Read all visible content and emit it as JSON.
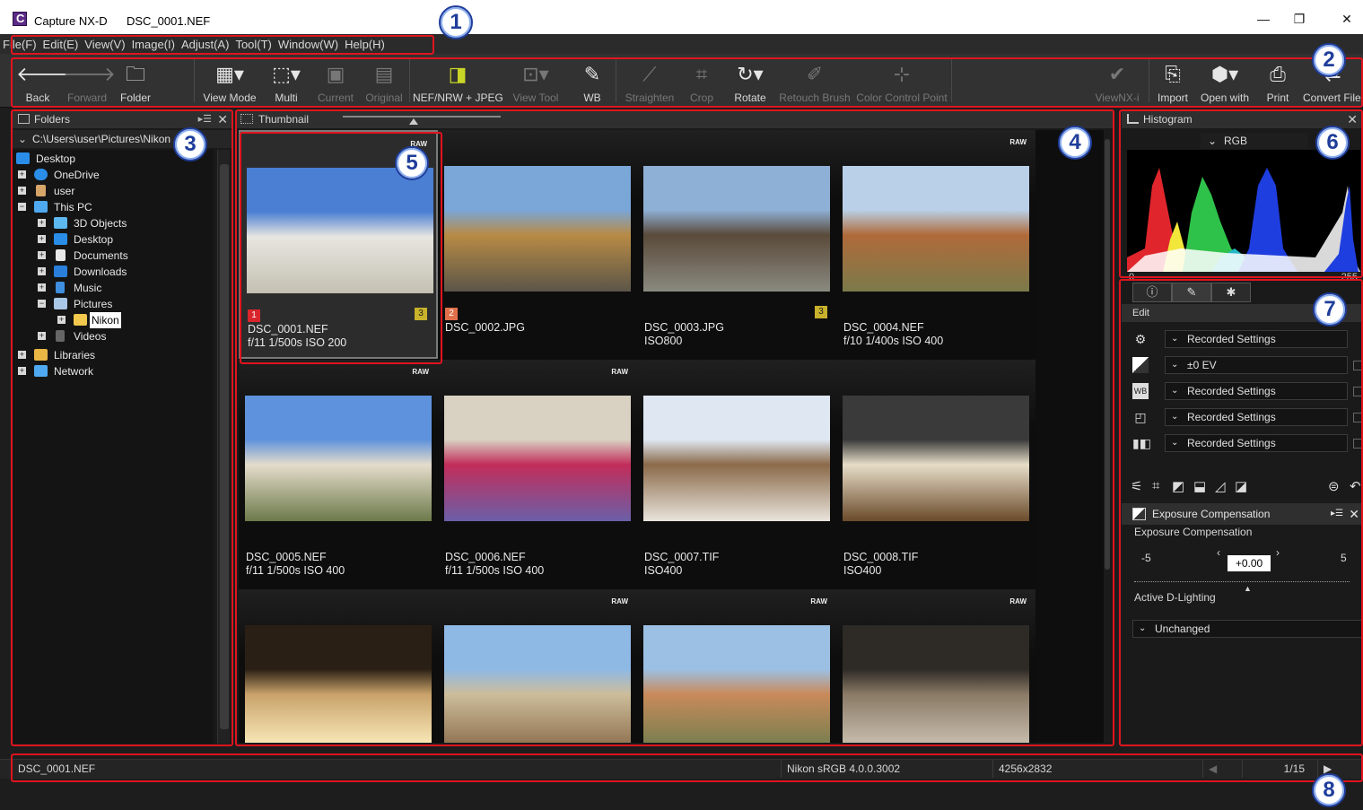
{
  "titlebar": {
    "app": "Capture NX-D",
    "file": "DSC_0001.NEF",
    "minimize": "—",
    "restore": "❐",
    "close": "✕"
  },
  "menu": [
    "File(F)",
    "Edit(E)",
    "View(V)",
    "Image(I)",
    "Adjust(A)",
    "Tool(T)",
    "Window(W)",
    "Help(H)"
  ],
  "toolbar": {
    "back": "Back",
    "forward": "Forward",
    "folder": "Folder",
    "view_mode": "View Mode",
    "multi": "Multi",
    "current": "Current",
    "original": "Original",
    "nef_jpeg": "NEF/NRW + JPEG",
    "view_tool": "View Tool",
    "wb": "WB",
    "straighten": "Straighten",
    "crop": "Crop",
    "rotate": "Rotate",
    "retouch": "Retouch Brush",
    "ccp": "Color Control Point",
    "viewnx": "ViewNX-i",
    "import": "Import",
    "open_with": "Open with",
    "print": "Print",
    "convert": "Convert Files"
  },
  "folders": {
    "title": "Folders",
    "path": "C:\\Users\\user\\Pictures\\Nikon",
    "tree": [
      "Desktop",
      "OneDrive",
      "user",
      "This PC",
      "3D Objects",
      "Desktop",
      "Documents",
      "Downloads",
      "Music",
      "Pictures",
      "Nikon",
      "Videos",
      "Libraries",
      "Network"
    ]
  },
  "thumbnail": {
    "title": "Thumbnail",
    "badge": "RAW",
    "items": [
      {
        "name": "DSC_0001.NEF",
        "meta": "f/11 1/500s ISO 200",
        "label": "1",
        "label_color": "#d9262c",
        "star": "3",
        "raw": true
      },
      {
        "name": "DSC_0002.JPG",
        "meta": "",
        "label": "2",
        "label_color": "#e0704a",
        "star": "",
        "raw": false
      },
      {
        "name": "DSC_0003.JPG",
        "meta": "ISO800",
        "label": "",
        "star": "3",
        "raw": false
      },
      {
        "name": "DSC_0004.NEF",
        "meta": "f/10 1/400s ISO 400",
        "label": "",
        "star": "",
        "raw": true
      },
      {
        "name": "DSC_0005.NEF",
        "meta": "f/11 1/500s ISO 400",
        "label": "",
        "star": "",
        "raw": true
      },
      {
        "name": "DSC_0006.NEF",
        "meta": "f/11 1/500s ISO 400",
        "label": "",
        "star": "",
        "raw": true
      },
      {
        "name": "DSC_0007.TIF",
        "meta": "ISO400",
        "label": "",
        "star": "",
        "raw": false
      },
      {
        "name": "DSC_0008.TIF",
        "meta": "ISO400",
        "label": "",
        "star": "",
        "raw": false
      },
      {
        "name": "",
        "meta": "",
        "label": "",
        "star": "",
        "raw": false
      },
      {
        "name": "",
        "meta": "",
        "label": "",
        "star": "",
        "raw": true
      },
      {
        "name": "",
        "meta": "",
        "label": "",
        "star": "",
        "raw": true
      },
      {
        "name": "",
        "meta": "",
        "label": "",
        "star": "",
        "raw": true
      }
    ]
  },
  "histogram": {
    "title": "Histogram",
    "channel": "RGB",
    "min": "0",
    "max": "255"
  },
  "edit": {
    "tab_header": "Edit",
    "rows": [
      {
        "icon": "gear-icon",
        "value": "Recorded Settings"
      },
      {
        "icon": "exposure-icon",
        "value": "±0 EV"
      },
      {
        "icon": "wb-icon",
        "value": "Recorded Settings"
      },
      {
        "icon": "picture-control-icon",
        "value": "Recorded Settings"
      },
      {
        "icon": "tone-icon",
        "value": "Recorded Settings"
      }
    ],
    "sub_title": "Exposure Compensation",
    "ev_label": "Exposure Compensation",
    "ev_min": "-5",
    "ev_max": "5",
    "ev_value": "+0.00",
    "adl_label": "Active D-Lighting",
    "adl_value": "Unchanged"
  },
  "status": {
    "file": "DSC_0001.NEF",
    "profile": "Nikon sRGB 4.0.0.3002",
    "size": "4256x2832",
    "page": "1/15"
  },
  "callouts": [
    "1",
    "2",
    "3",
    "4",
    "5",
    "6",
    "7",
    "8"
  ],
  "colors": {
    "callout_border": "#e0141e",
    "callout_text": "#1f3d9a"
  }
}
